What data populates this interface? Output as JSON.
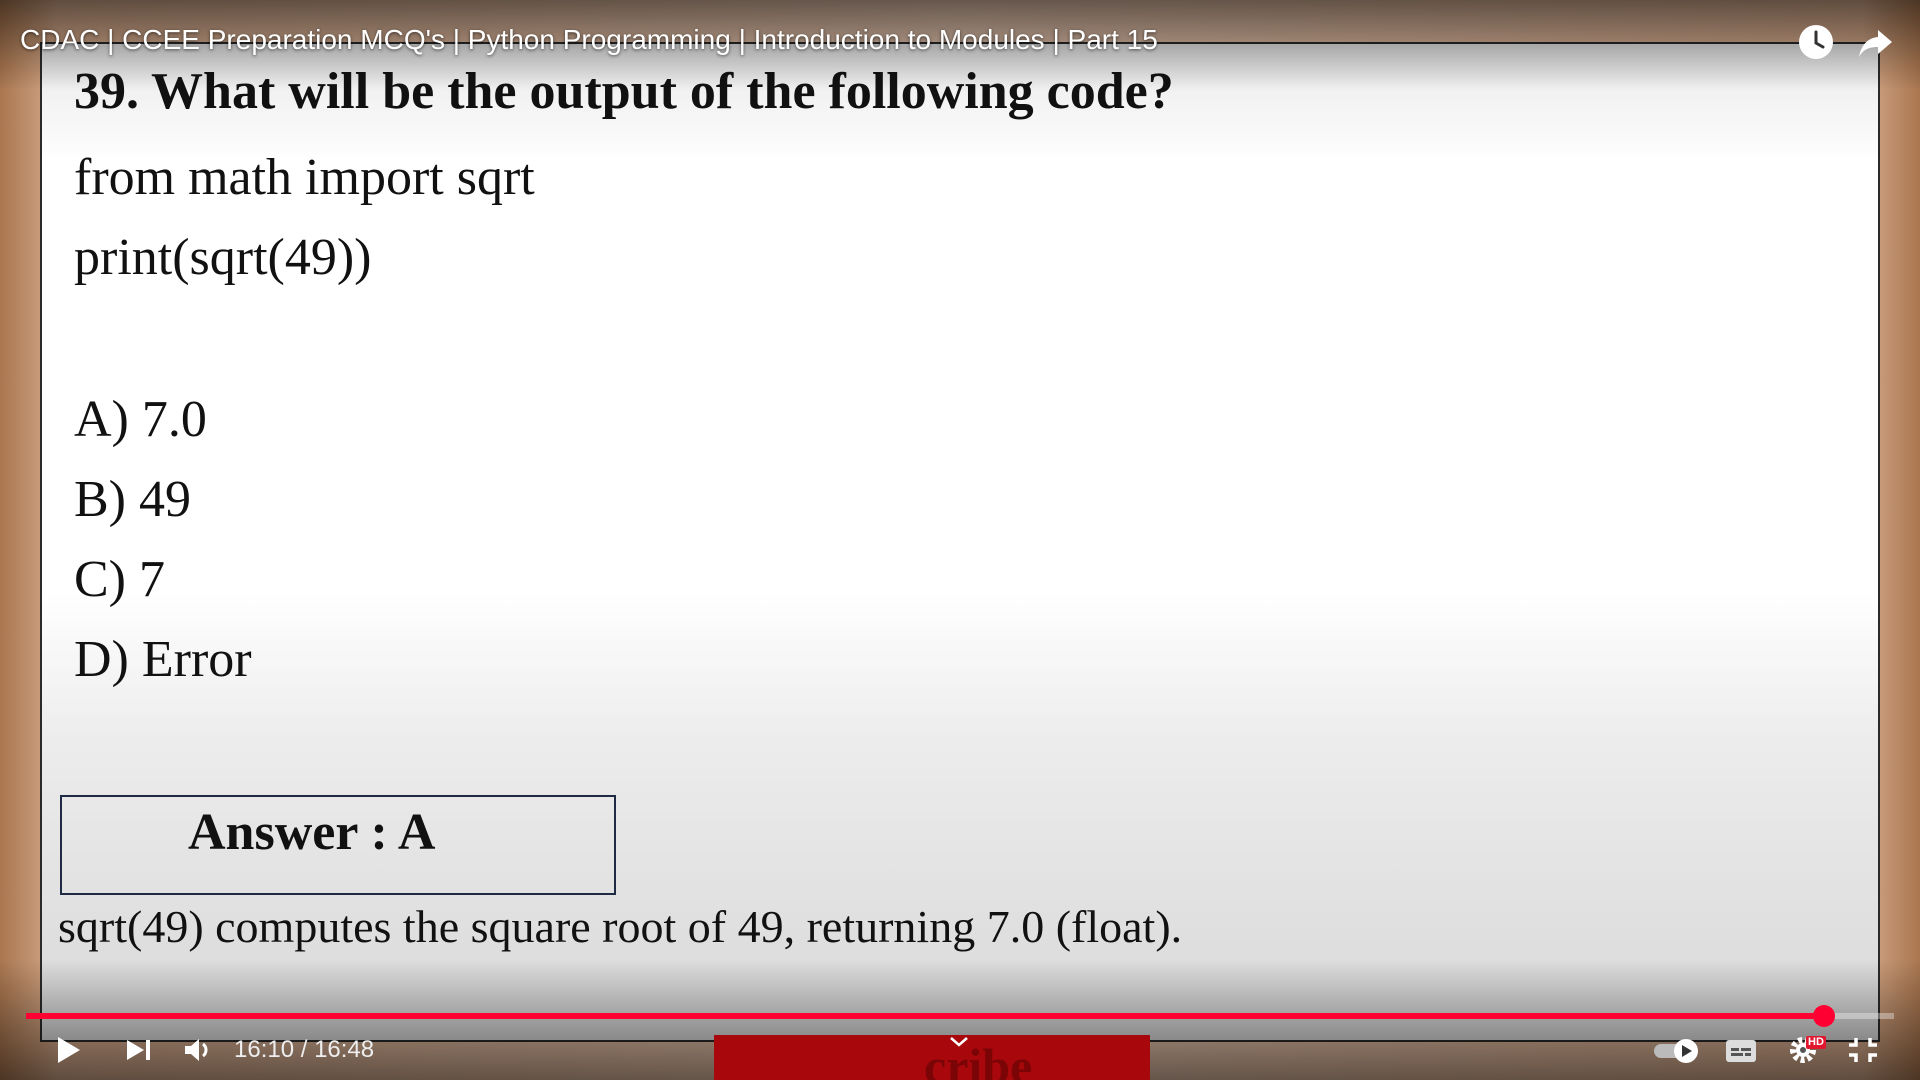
{
  "video": {
    "title": "CDAC | CCEE Preparation MCQ's | Python Programming | Introduction to Modules | Part 15",
    "time_display": "16:10 / 16:48",
    "progress_fraction": 0.9623,
    "accent_color": "#ff0033",
    "hd_badge": "HD",
    "icons": [
      "watch-later-icon",
      "share-icon",
      "play-icon",
      "next-icon",
      "volume-icon",
      "autoplay-toggle-icon",
      "subtitles-icon",
      "settings-icon",
      "exit-fullscreen-icon"
    ]
  },
  "slide": {
    "question": "39. What will be the output of  the following code?",
    "code": [
      "from math import sqrt",
      "print(sqrt(49))"
    ],
    "options": [
      "A) 7.0",
      "B) 49",
      "C) 7",
      "D) Error"
    ],
    "answer": "Answer : A",
    "explanation": "sqrt(49) computes the square root of  49, returning 7.0 (float)."
  },
  "overlay": {
    "subscribe_fragment": "cribe"
  }
}
